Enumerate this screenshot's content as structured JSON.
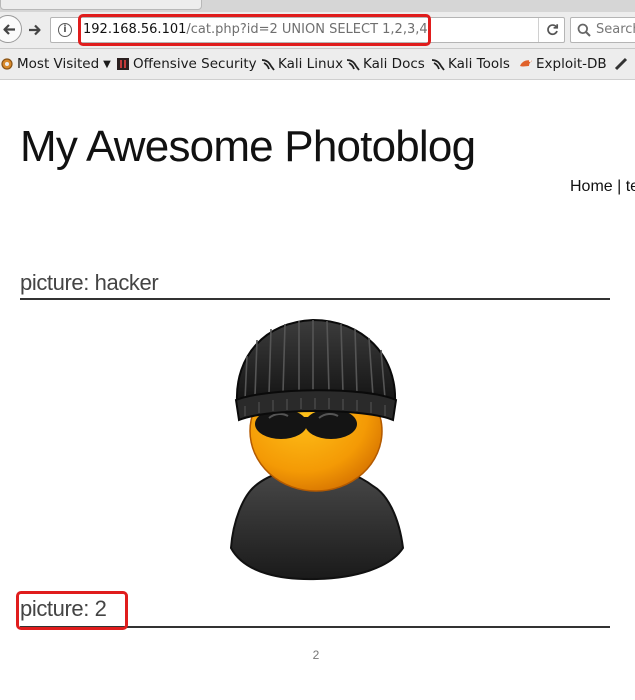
{
  "browser": {
    "url_host": "192.168.56.101",
    "url_path": "/cat.php?id=2 UNION SELECT 1,2,3,4",
    "search_placeholder": "Search"
  },
  "bookmarks": [
    {
      "label": "Most Visited",
      "icon": "gear-icon",
      "has_dropdown": true
    },
    {
      "label": "Offensive Security",
      "icon": "offsec-icon"
    },
    {
      "label": "Kali Linux",
      "icon": "kali-dragon-icon"
    },
    {
      "label": "Kali Docs",
      "icon": "kali-dragon-icon"
    },
    {
      "label": "Kali Tools",
      "icon": "kali-dragon-icon"
    },
    {
      "label": "Exploit-DB",
      "icon": "exploit-db-icon"
    }
  ],
  "blog": {
    "title": "My Awesome Photoblog",
    "nav_home": "Home",
    "nav_separator": " | ",
    "nav_next": "te"
  },
  "pictures": [
    {
      "heading": "picture: hacker",
      "image": "hacker-avatar"
    },
    {
      "heading": "picture: 2",
      "caption": "2"
    }
  ],
  "colors": {
    "highlight": "#e01d1d",
    "chrome": "#ededed",
    "rule": "#333333"
  }
}
